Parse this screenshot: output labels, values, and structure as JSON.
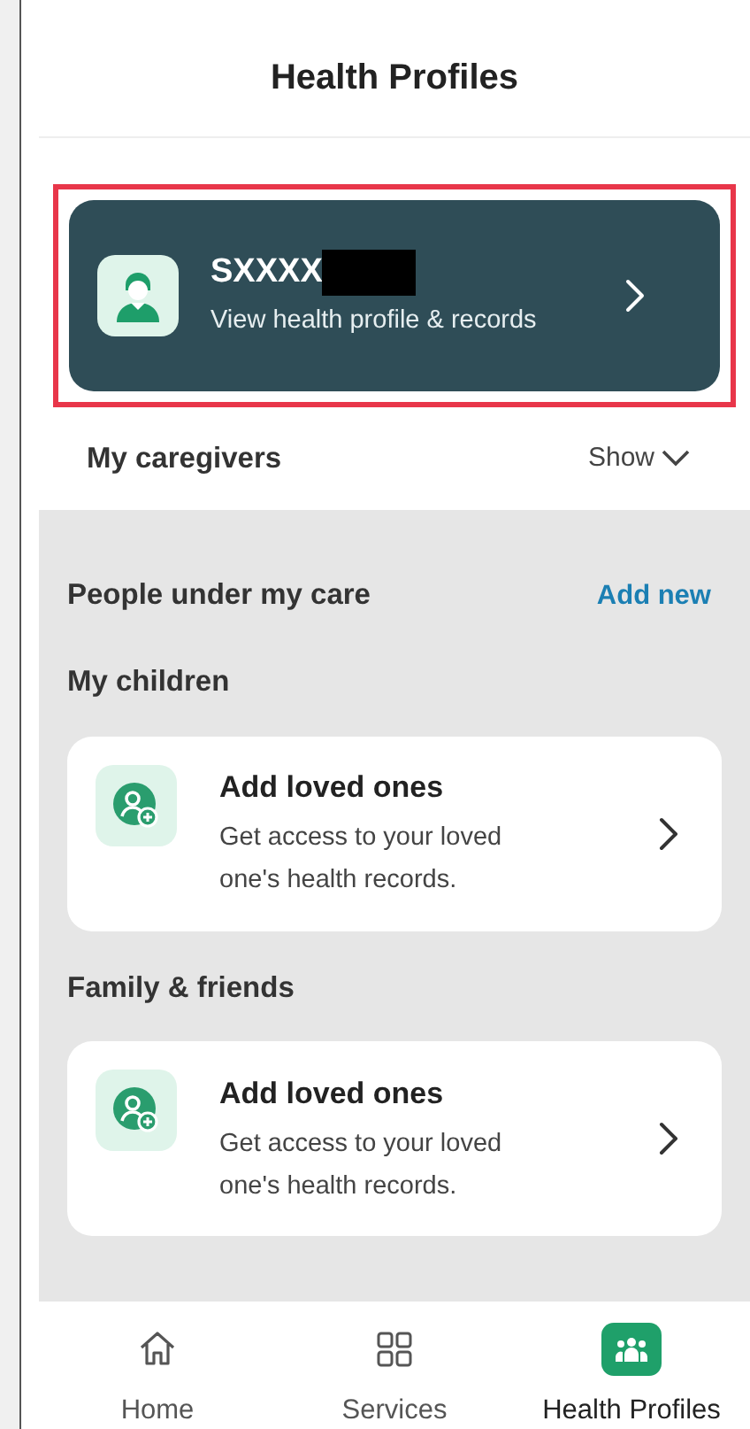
{
  "header": {
    "title": "Health Profiles"
  },
  "profile_card": {
    "name": "SXXXX",
    "subtitle": "View health profile & records",
    "highlighted": true,
    "redacted": true
  },
  "caregivers": {
    "label": "My caregivers",
    "toggle": "Show"
  },
  "care_section": {
    "title": "People under my care",
    "action": "Add new",
    "groups": [
      {
        "title": "My children",
        "card": {
          "title": "Add loved ones",
          "description": "Get access to your loved one's health records."
        }
      },
      {
        "title": "Family & friends",
        "card": {
          "title": "Add loved ones",
          "description": "Get access to your loved one's health records."
        }
      }
    ]
  },
  "bottom_nav": [
    {
      "kind": "home",
      "label": "Home",
      "selected": false
    },
    {
      "kind": "services",
      "label": "Services",
      "selected": false
    },
    {
      "kind": "profiles",
      "label": "Health Profiles",
      "selected": true
    }
  ]
}
